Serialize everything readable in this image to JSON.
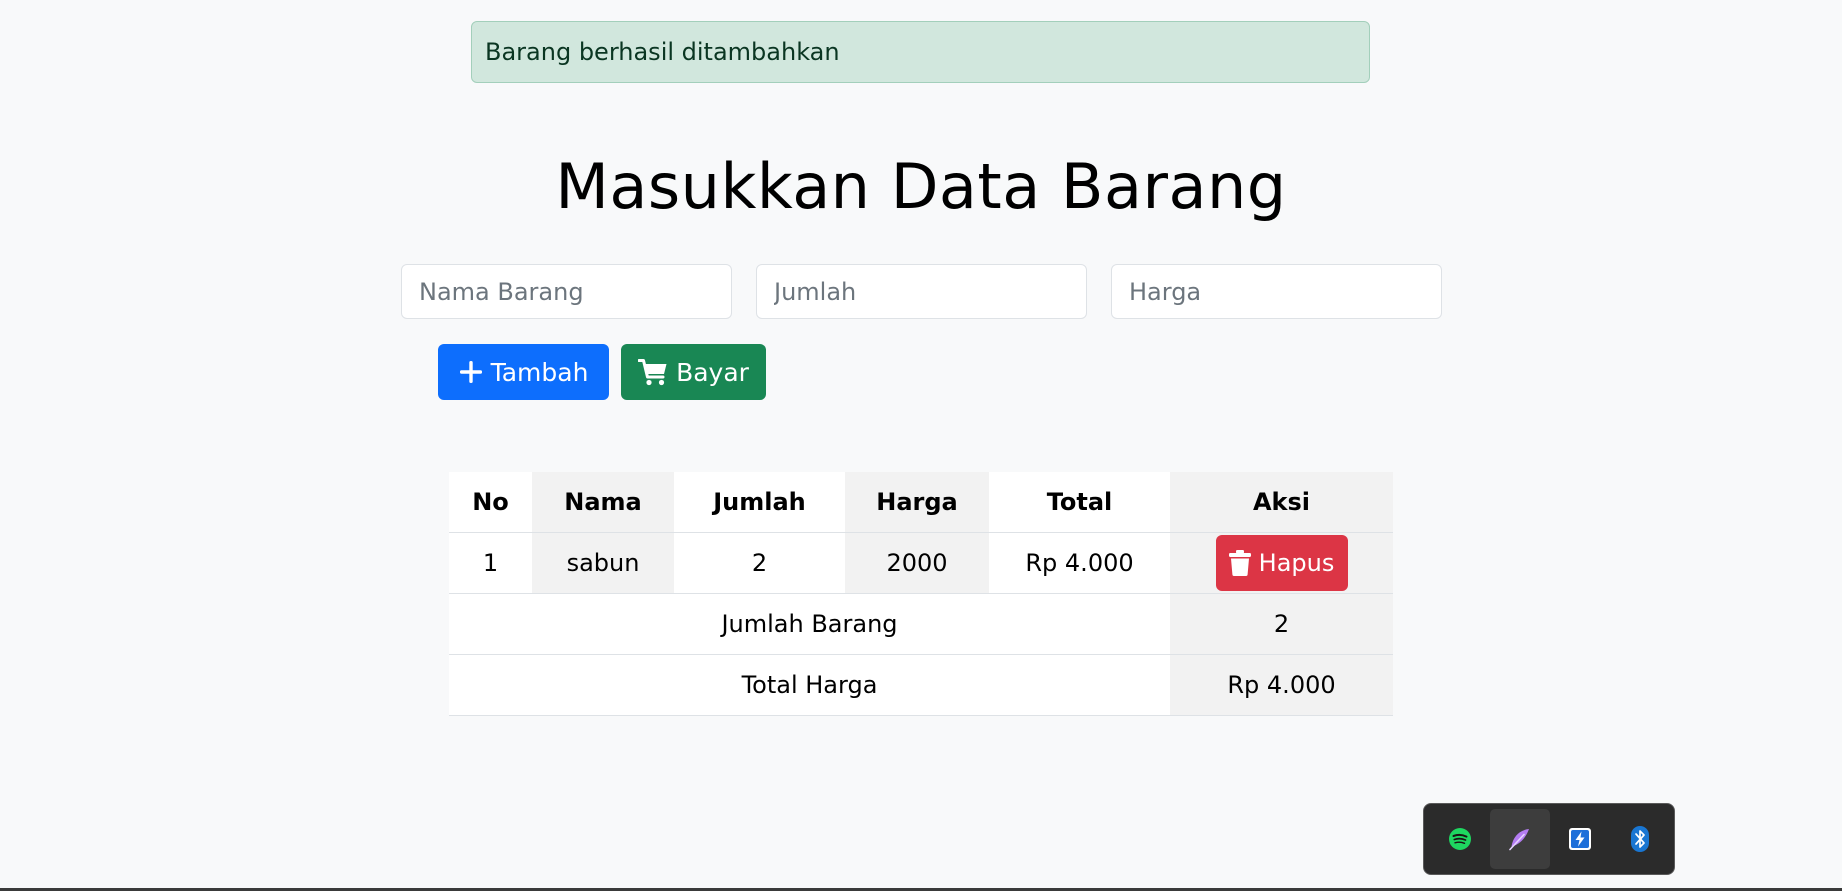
{
  "alert": {
    "message": "Barang berhasil ditambahkan"
  },
  "page": {
    "title": "Masukkan Data Barang"
  },
  "form": {
    "nama_placeholder": "Nama Barang",
    "jumlah_placeholder": "Jumlah",
    "harga_placeholder": "Harga",
    "nama_value": "",
    "jumlah_value": "",
    "harga_value": ""
  },
  "buttons": {
    "add_label": "Tambah",
    "add_icon": "plus-icon",
    "pay_label": "Bayar",
    "pay_icon": "cart-icon"
  },
  "table": {
    "headers": [
      "No",
      "Nama",
      "Jumlah",
      "Harga",
      "Total",
      "Aksi"
    ],
    "rows": [
      {
        "no": "1",
        "nama": "sabun",
        "jumlah": "2",
        "harga": "2000",
        "total": "Rp 4.000",
        "action_label": "Hapus",
        "action_icon": "trash-icon"
      }
    ],
    "summary": {
      "count_label": "Jumlah Barang",
      "count_value": "2",
      "total_label": "Total Harga",
      "total_value": "Rp 4.000"
    }
  },
  "tray": {
    "icons": [
      "spotify-icon",
      "feather-icon",
      "flash-icon",
      "bluetooth-icon"
    ]
  },
  "colors": {
    "primary": "#0d6efd",
    "success": "#198754",
    "danger": "#dc3545",
    "alert_bg": "#d1e7dd",
    "alert_text": "#0a3622",
    "page_bg": "#f8f9fa"
  }
}
